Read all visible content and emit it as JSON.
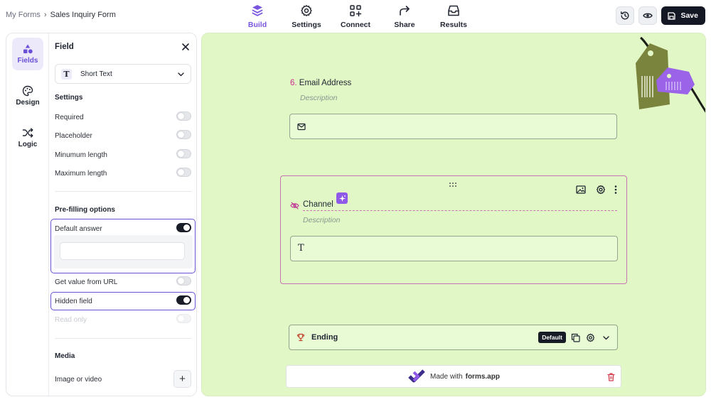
{
  "breadcrumb": {
    "root": "My Forms",
    "separator": "›",
    "current": "Sales Inquiry Form"
  },
  "nav": [
    {
      "label": "Build",
      "icon": "layers-icon",
      "active": true
    },
    {
      "label": "Settings",
      "icon": "gear-icon",
      "active": false
    },
    {
      "label": "Connect",
      "icon": "connect-grid-icon",
      "active": false
    },
    {
      "label": "Share",
      "icon": "share-arrow-icon",
      "active": false
    },
    {
      "label": "Results",
      "icon": "inbox-icon",
      "active": false
    }
  ],
  "actions": {
    "history_icon": "history-icon",
    "preview_icon": "eye-icon",
    "save_label": "Save"
  },
  "rail": [
    {
      "label": "Fields",
      "icon": "shapes-icon",
      "active": true
    },
    {
      "label": "Design",
      "icon": "palette-icon",
      "active": false
    },
    {
      "label": "Logic",
      "icon": "shuffle-icon",
      "active": false
    }
  ],
  "field_panel": {
    "title": "Field",
    "type": {
      "icon_glyph": "T",
      "value": "Short Text"
    },
    "settings_title": "Settings",
    "settings": [
      {
        "label": "Required",
        "on": false
      },
      {
        "label": "Placeholder",
        "on": false
      },
      {
        "label": "Minumum length",
        "on": false
      },
      {
        "label": "Maximum length",
        "on": false
      }
    ],
    "prefill_title": "Pre-filling options",
    "default_answer": {
      "label": "Default answer",
      "on": true,
      "value": ""
    },
    "get_value_from_url": {
      "label": "Get value from URL",
      "on": false
    },
    "hidden_field": {
      "label": "Hidden field",
      "on": true
    },
    "read_only": {
      "label": "Read only",
      "on": false,
      "disabled": true
    },
    "media_title": "Media",
    "image_or_video": {
      "label": "Image or video",
      "button": "+"
    }
  },
  "canvas": {
    "background": "#e1f8c6",
    "question6": {
      "number": "6.",
      "title": "Email Address",
      "description": "Description"
    },
    "question_channel": {
      "title": "Channel",
      "description": "Description",
      "hidden": true
    },
    "ending": {
      "label": "Ending",
      "badge": "Default"
    },
    "made_with": {
      "prefix": "Made with",
      "brand": "forms.app"
    }
  },
  "colors": {
    "accent": "#6b4fd6",
    "pink_number": "#cc2b8a",
    "dark": "#141824",
    "selected_border": "#c873b4"
  }
}
